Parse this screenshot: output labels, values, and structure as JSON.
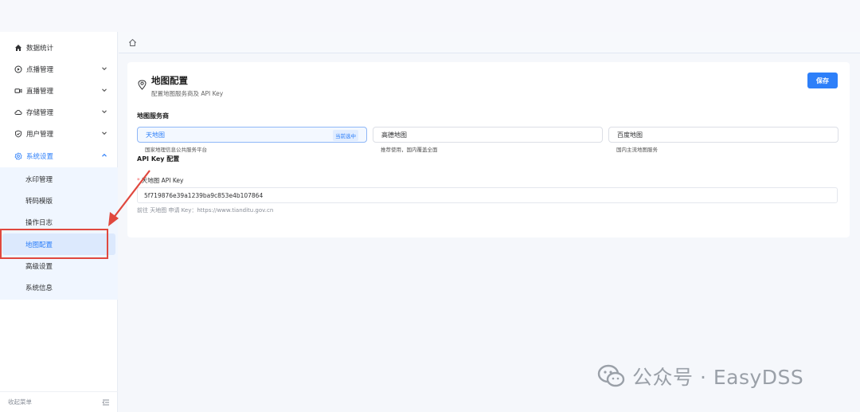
{
  "sidebar": {
    "items": [
      {
        "label": "数据统计",
        "icon": "home-icon"
      },
      {
        "label": "点播管理",
        "icon": "play-circle-icon"
      },
      {
        "label": "直播管理",
        "icon": "video-camera-icon"
      },
      {
        "label": "存储管理",
        "icon": "cloud-icon"
      },
      {
        "label": "用户管理",
        "icon": "shield-icon"
      },
      {
        "label": "系统设置",
        "icon": "gear-icon"
      }
    ],
    "submenu": [
      {
        "label": "水印管理"
      },
      {
        "label": "转码模版"
      },
      {
        "label": "操作日志"
      },
      {
        "label": "地图配置"
      },
      {
        "label": "高级设置"
      },
      {
        "label": "系统信息"
      }
    ],
    "footer_label": "收起菜单"
  },
  "page": {
    "title": "地图配置",
    "subtitle": "配置地图服务商及 API Key",
    "save_label": "保存",
    "provider_section": "地图服务商",
    "providers": [
      {
        "name": "天地图",
        "desc": "国家地理信息公共服务平台",
        "badge": "当前选中"
      },
      {
        "name": "高德地图",
        "desc": "推荐使用，国内覆盖全面"
      },
      {
        "name": "百度地图",
        "desc": "国内主流地图服务"
      }
    ],
    "key_section": "API Key 配置",
    "key_field_label": "天地图 API Key",
    "key_value": "5f719876e39a1239ba9c853e4b107864",
    "key_hint": "前往 天地图 申请 Key：https://www.tianditu.gov.cn"
  },
  "watermark": {
    "text": "公众号 · EasyDSS"
  },
  "colors": {
    "accent": "#2d7ff9",
    "annotation": "#e0483e"
  }
}
